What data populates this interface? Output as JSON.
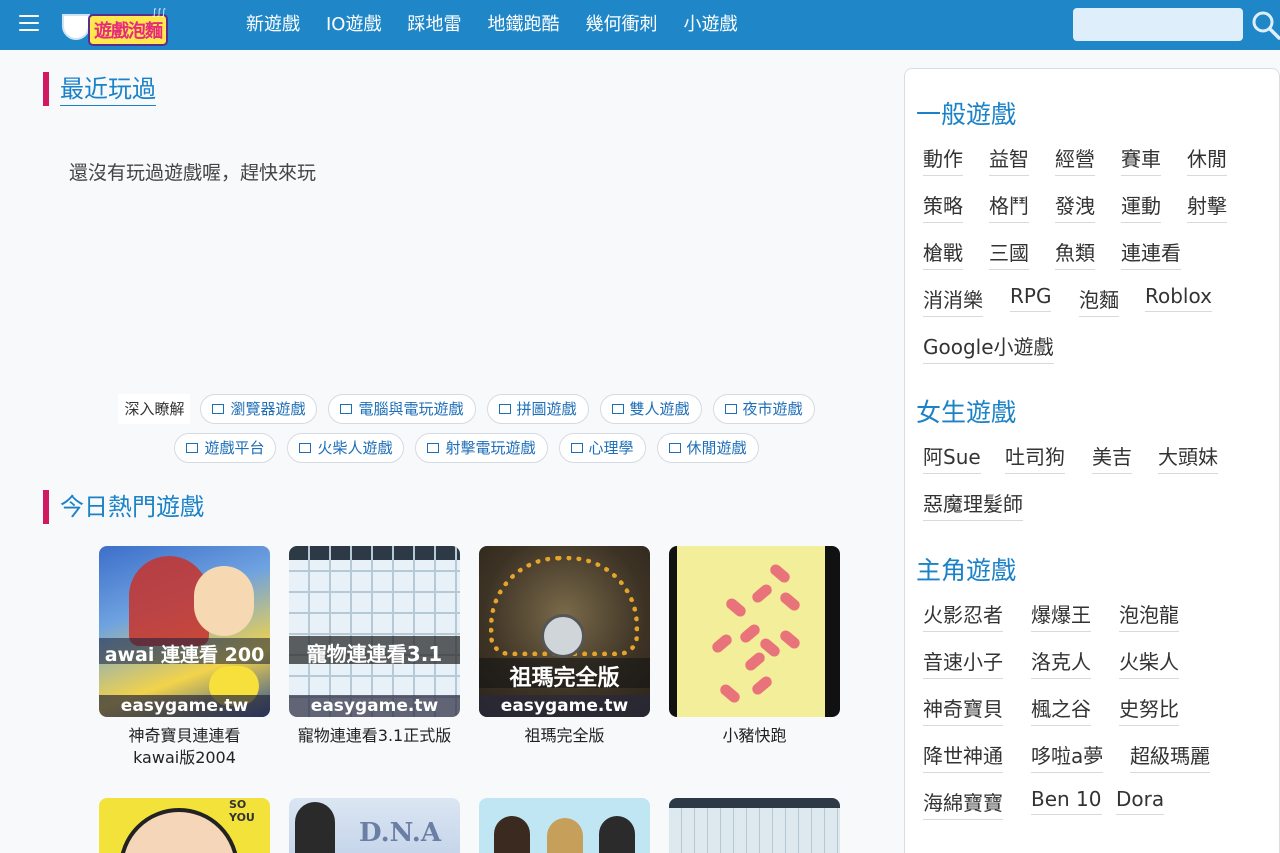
{
  "header": {
    "menu_icon": "hamburger-icon",
    "logo_text": "遊戲泡麵",
    "nav": [
      "新遊戲",
      "IO遊戲",
      "踩地雷",
      "地鐵跑酷",
      "幾何衝刺",
      "小遊戲"
    ],
    "search_placeholder": "",
    "search_icon": "search-icon"
  },
  "recent": {
    "title": "最近玩過",
    "empty_message": "還沒有玩過遊戲喔，趕快來玩"
  },
  "deep_dive": {
    "label": "深入瞭解",
    "row1": [
      "瀏覽器遊戲",
      "電腦與電玩遊戲",
      "拼圖遊戲",
      "雙人遊戲",
      "夜市遊戲"
    ],
    "row2": [
      "遊戲平台",
      "火柴人遊戲",
      "射擊電玩遊戲",
      "心理學",
      "休閒遊戲"
    ]
  },
  "hot": {
    "title": "今日熱門遊戲",
    "games": [
      {
        "title": "神奇寶貝連連看kawai版2004",
        "thumb_text": "awai 連連看 200",
        "thumb_footer": "easygame.tw"
      },
      {
        "title": "寵物連連看3.1正式版",
        "thumb_text": "寵物連連看3.1",
        "thumb_footer": "easygame.tw"
      },
      {
        "title": "祖瑪完全版",
        "thumb_text": "祖瑪完全版",
        "thumb_footer": "easygame.tw"
      },
      {
        "title": "小豬快跑",
        "thumb_text": "",
        "thumb_footer": ""
      }
    ]
  },
  "sidebar": {
    "general": {
      "title": "一般遊戲",
      "links": [
        "動作",
        "益智",
        "經營",
        "賽車",
        "休閒",
        "策略",
        "格鬥",
        "發洩",
        "運動",
        "射擊",
        "槍戰",
        "三國",
        "魚類",
        "連連看",
        "消消樂",
        "RPG",
        "泡麵",
        "Roblox",
        "Google小遊戲"
      ]
    },
    "girls": {
      "title": "女生遊戲",
      "links": [
        "阿Sue",
        "吐司狗",
        "美吉",
        "大頭妹",
        "惡魔理髮師"
      ]
    },
    "characters": {
      "title": "主角遊戲",
      "links": [
        "火影忍者",
        "爆爆王",
        "泡泡龍",
        "音速小子",
        "洛克人",
        "火柴人",
        "神奇寶貝",
        "楓之谷",
        "史努比",
        "降世神通",
        "哆啦a夢",
        "超級瑪麗",
        "海綿寶寶",
        "Ben 10",
        "Dora"
      ]
    }
  }
}
